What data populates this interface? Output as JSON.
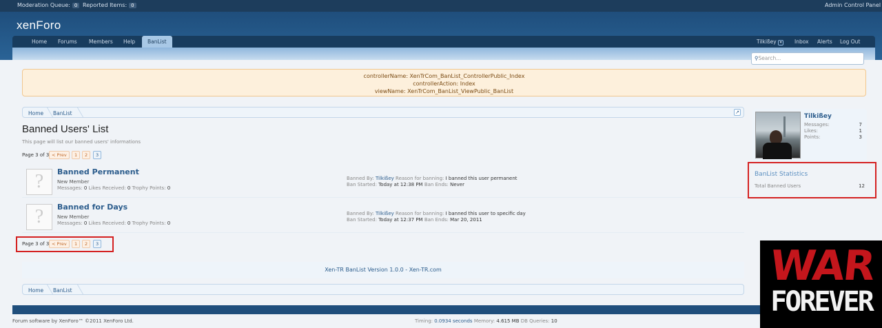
{
  "topbar": {
    "moderation_label": "Moderation Queue:",
    "moderation_count": "0",
    "reported_label": "Reported Items:",
    "reported_count": "0",
    "admin_link": "Admin Control Panel"
  },
  "header": {
    "logo": "xenForo"
  },
  "nav": {
    "tabs": [
      "Home",
      "Forums",
      "Members",
      "Help",
      "BanList"
    ],
    "active_tab": "BanList",
    "user": "Tilkißey",
    "user_menu_icon": "chevron-down-icon",
    "right_links": [
      "Inbox",
      "Alerts",
      "Log Out"
    ]
  },
  "search": {
    "placeholder": "Search..."
  },
  "debug": {
    "line1": "controllerName: XenTrCom_BanList_ControllerPublic_Index",
    "line2": "controllerAction: Index",
    "line3": "viewName: XenTrCom_BanList_ViewPublic_BanList"
  },
  "breadcrumb": {
    "items": [
      "Home",
      "BanList"
    ]
  },
  "page": {
    "title": "Banned Users' List",
    "subtitle": "This page will list our banned users' informations"
  },
  "pagination": {
    "label": "Page 3 of 3",
    "prev": "< Prev",
    "pages": [
      "1",
      "2",
      "3"
    ],
    "current": "3"
  },
  "bans": [
    {
      "name": "Banned Permanent",
      "title": "New Member",
      "messages_label": "Messages:",
      "messages": "0",
      "likes_label": "Likes Received:",
      "likes": "0",
      "trophy_label": "Trophy Points:",
      "trophy": "0",
      "banned_by_label": "Banned By:",
      "banned_by": "Tilkißey",
      "reason_label": "Reason for banning:",
      "reason": "I banned this user permanent",
      "started_label": "Ban Started:",
      "started": "Today at 12:38 PM",
      "ends_label": "Ban Ends:",
      "ends": "Never"
    },
    {
      "name": "Banned for Days",
      "title": "New Member",
      "messages_label": "Messages:",
      "messages": "0",
      "likes_label": "Likes Received:",
      "likes": "0",
      "trophy_label": "Trophy Points:",
      "trophy": "0",
      "banned_by_label": "Banned By:",
      "banned_by": "Tilkißey",
      "reason_label": "Reason for banning:",
      "reason": "I banned this user to specific day",
      "started_label": "Ban Started:",
      "started": "Today at 12:37 PM",
      "ends_label": "Ban Ends:",
      "ends": "Mar 20, 2011"
    }
  ],
  "footbar": {
    "text": "Xen-TR BanList Version 1.0.0 - Xen-TR.com"
  },
  "sidebar": {
    "username": "Tilkißey",
    "stats": [
      {
        "label": "Messages:",
        "value": "7"
      },
      {
        "label": "Likes:",
        "value": "1"
      },
      {
        "label": "Points:",
        "value": "3"
      }
    ],
    "banlist_title": "BanList Statistics",
    "total_label": "Total Banned Users",
    "total_value": "12"
  },
  "footer": {
    "credit": "Forum software by XenForo™ ©2011 XenForo Ltd.",
    "timing_label": "Timing:",
    "timing_value": "0.0934 seconds",
    "memory_label": "Memory:",
    "memory_value": "4.615 MB",
    "queries_label": "DB Queries:",
    "queries_value": "10"
  },
  "overlay": {
    "line1": "WAR",
    "line2": "FOREVER"
  },
  "colors": {
    "header": "#1f4e7c",
    "link": "#2b5c8c",
    "highlight_box": "#d42020",
    "debug_bg": "#fdf0dc"
  }
}
